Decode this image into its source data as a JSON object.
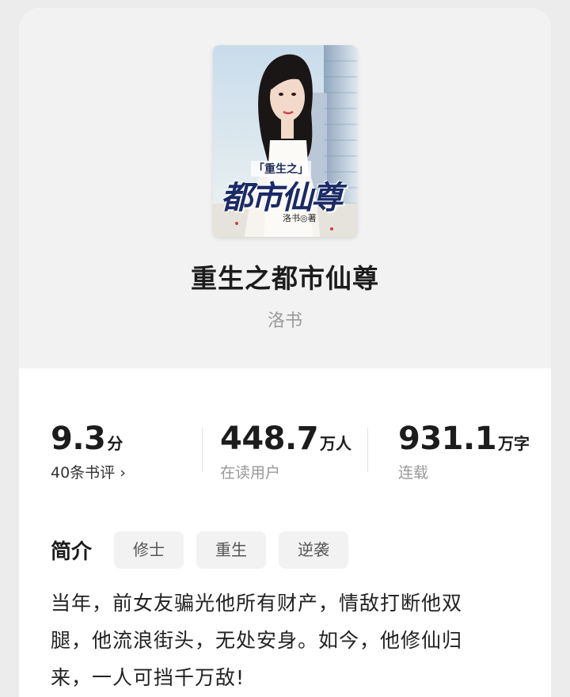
{
  "book": {
    "title": "重生之都市仙尊",
    "author": "洛书",
    "cover": {
      "small_title": "「重生之」",
      "big_title": "都市仙尊",
      "author_mark": "洛书◎著"
    }
  },
  "stats": {
    "rating": {
      "value": "9.3",
      "unit": "分",
      "sub": "40条书评 ›"
    },
    "readers": {
      "value": "448.7",
      "unit": "万人",
      "sub": "在读用户"
    },
    "words": {
      "value": "931.1",
      "unit": "万字",
      "sub": "连载"
    }
  },
  "intro": {
    "label": "简介",
    "tags": [
      "修士",
      "重生",
      "逆袭"
    ],
    "lines": [
      "当年，前女友骗光他所有财产，情敌打断他双",
      "腿，他流浪街头，无处安身。如今，他修仙归",
      "来，一人可挡千万敌!"
    ]
  },
  "colors": {
    "background": "#ececec",
    "hero": "#f2f2f2",
    "muted_text": "#999999",
    "tag_bg": "#f2f2f2"
  }
}
